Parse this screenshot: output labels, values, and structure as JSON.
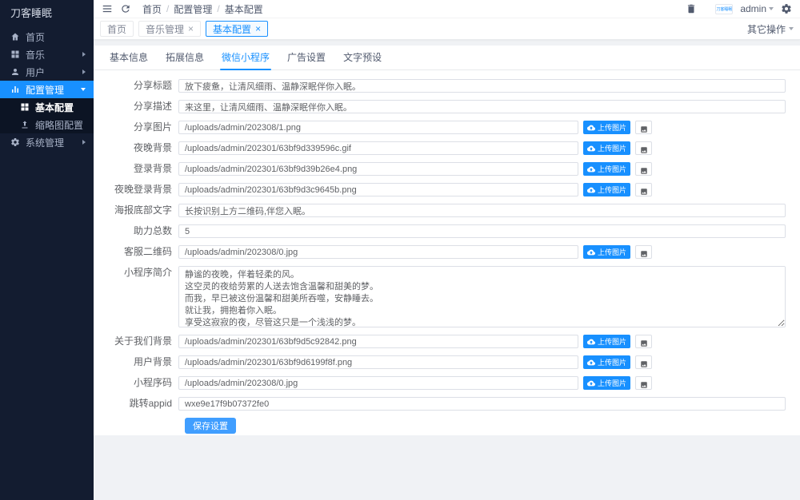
{
  "app": {
    "logo": "刀客睡眠",
    "user": "admin"
  },
  "colors": {
    "accent": "#1890ff",
    "sidebar_bg": "#131c30",
    "submenu_bg": "#0c1424",
    "content_bg": "#f0f2f5",
    "save_button": "#409eff"
  },
  "topbar": {
    "breadcrumb": [
      "首页",
      "配置管理",
      "基本配置"
    ],
    "icons": [
      "menu-icon",
      "refresh-icon",
      "trash-icon",
      "gear-icon"
    ]
  },
  "sidebar": {
    "items": [
      {
        "name": "home",
        "label": "首页",
        "icon": "home-icon"
      },
      {
        "name": "music",
        "label": "音乐",
        "icon": "grid-icon",
        "expandable": true
      },
      {
        "name": "users",
        "label": "用户",
        "icon": "user-icon",
        "expandable": true
      },
      {
        "name": "config",
        "label": "配置管理",
        "icon": "chart-icon",
        "expandable": true,
        "expanded": true,
        "active": true,
        "children": [
          {
            "name": "basic-config",
            "label": "基本配置",
            "icon": "grid-icon",
            "active": true
          },
          {
            "name": "thumbnail-config",
            "label": "缩略图配置",
            "icon": "upload-icon"
          }
        ]
      },
      {
        "name": "system",
        "label": "系统管理",
        "icon": "gear-icon",
        "expandable": true
      }
    ]
  },
  "tagbar": {
    "tags": [
      {
        "label": "首页",
        "closable": false,
        "active": false
      },
      {
        "label": "音乐管理",
        "closable": true,
        "active": false
      },
      {
        "label": "基本配置",
        "closable": true,
        "active": true
      }
    ],
    "more_label": "其它操作"
  },
  "page": {
    "tabs": [
      {
        "label": "基本信息",
        "active": false
      },
      {
        "label": "拓展信息",
        "active": false
      },
      {
        "label": "微信小程序",
        "active": true
      },
      {
        "label": "广告设置",
        "active": false
      },
      {
        "label": "文字预设",
        "active": false
      }
    ],
    "upload_button_label": "上传图片",
    "save_button_label": "保存设置",
    "fields": [
      {
        "name": "share-title",
        "label": "分享标题",
        "type": "text",
        "value": "放下疲惫，让清风细雨、温静深眠伴你入眠。"
      },
      {
        "name": "share-desc",
        "label": "分享描述",
        "type": "text",
        "value": "来这里，让清风细雨、温静深眠伴你入眠。"
      },
      {
        "name": "share-image",
        "label": "分享图片",
        "type": "upload",
        "value": "/uploads/admin/202308/1.png"
      },
      {
        "name": "night-background",
        "label": "夜晚背景",
        "type": "upload",
        "value": "/uploads/admin/202301/63bf9d339596c.gif"
      },
      {
        "name": "login-background",
        "label": "登录背景",
        "type": "upload",
        "value": "/uploads/admin/202301/63bf9d39b26e4.png"
      },
      {
        "name": "night-login-background",
        "label": "夜晚登录背景",
        "type": "upload",
        "value": "/uploads/admin/202301/63bf9d3c9645b.png"
      },
      {
        "name": "poster-bottom-text",
        "label": "海报底部文字",
        "type": "text",
        "value": "长按识别上方二维码,伴您入眠。"
      },
      {
        "name": "boost-total",
        "label": "助力总数",
        "type": "text",
        "value": "5"
      },
      {
        "name": "service-qrcode",
        "label": "客服二维码",
        "type": "upload",
        "value": "/uploads/admin/202308/0.jpg"
      },
      {
        "name": "mini-program-intro",
        "label": "小程序简介",
        "type": "textarea",
        "value": "静谧的夜晚，伴着轻柔的风。\n这空灵的夜给劳累的人送去饱含温馨和甜美的梦。\n而我，早已被这份温馨和甜美所吞噬，安静睡去。\n就让我，拥抱着你入眠。\n享受这寂寂的夜，尽管这只是一个浅浅的梦。"
      },
      {
        "name": "about-us-background",
        "label": "关于我们背景",
        "type": "upload",
        "value": "/uploads/admin/202301/63bf9d5c92842.png"
      },
      {
        "name": "user-background",
        "label": "用户背景",
        "type": "upload",
        "value": "/uploads/admin/202301/63bf9d6199f8f.png"
      },
      {
        "name": "mini-program-qrcode",
        "label": "小程序码",
        "type": "upload",
        "value": "/uploads/admin/202308/0.jpg"
      },
      {
        "name": "redirect-appid",
        "label": "跳转appid",
        "type": "text",
        "value": "wxe9e17f9b07372fe0"
      }
    ]
  }
}
